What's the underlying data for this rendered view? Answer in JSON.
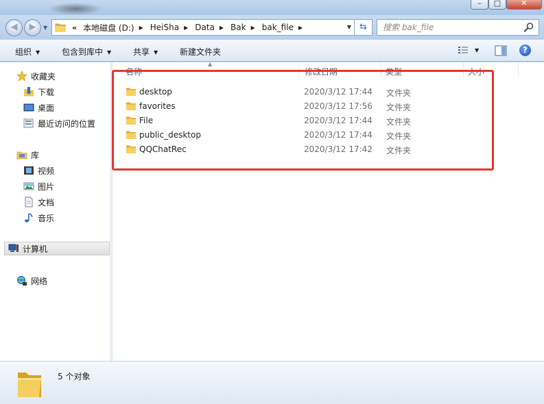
{
  "window": {
    "controls": {
      "minimize": "–",
      "maximize": "□",
      "close": "✕"
    }
  },
  "address": {
    "lead": "«",
    "crumbs": [
      "本地磁盘 (D:)",
      "HeiSha",
      "Data",
      "Bak",
      "bak_file"
    ],
    "search_placeholder": "搜索 bak_file"
  },
  "toolbar": {
    "organize": "组织",
    "include_library": "包含到库中",
    "share": "共享",
    "new_folder": "新建文件夹",
    "help": "?"
  },
  "nav": {
    "favorites": "收藏夹",
    "downloads": "下载",
    "desktop": "桌面",
    "recent": "最近访问的位置",
    "libraries": "库",
    "videos": "视频",
    "pictures": "图片",
    "documents": "文档",
    "music": "音乐",
    "computer": "计算机",
    "network": "网络"
  },
  "columns": {
    "name": "名称",
    "date": "修改日期",
    "type": "类型",
    "size": "大小"
  },
  "files": [
    {
      "name": "desktop",
      "date": "2020/3/12 17:44",
      "type": "文件夹"
    },
    {
      "name": "favorites",
      "date": "2020/3/12 17:56",
      "type": "文件夹"
    },
    {
      "name": "File",
      "date": "2020/3/12 17:44",
      "type": "文件夹"
    },
    {
      "name": "public_desktop",
      "date": "2020/3/12 17:44",
      "type": "文件夹"
    },
    {
      "name": "QQChatRec",
      "date": "2020/3/12 17:42",
      "type": "文件夹"
    }
  ],
  "status": {
    "count": "5 个对象"
  },
  "colors": {
    "highlight": "#e8342c",
    "folder": "#f0c64a",
    "accent": "#3a6fb4"
  }
}
